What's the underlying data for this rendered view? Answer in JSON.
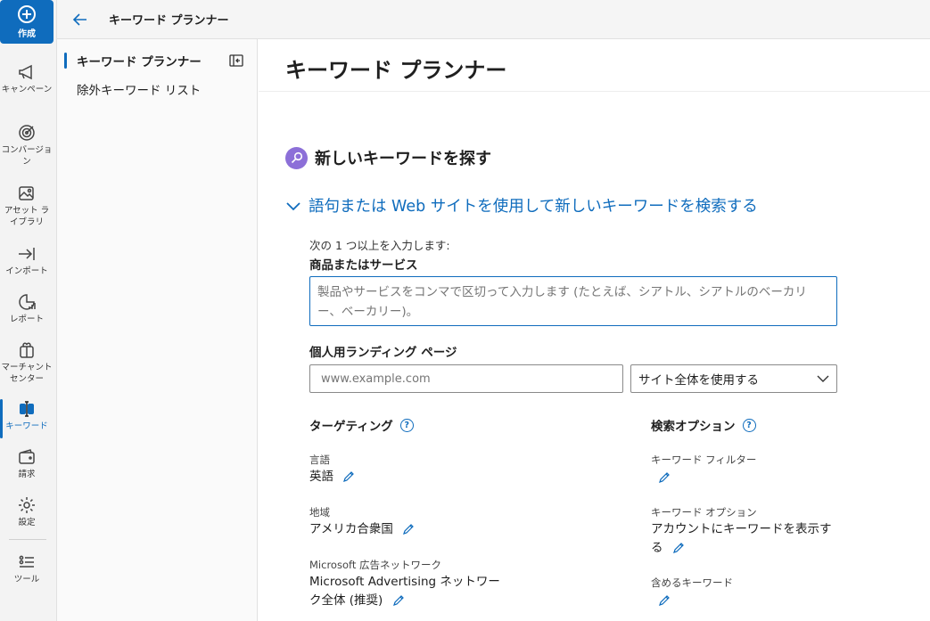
{
  "rail": {
    "create_label": "作成",
    "items": [
      {
        "label": "キャンペーン",
        "icon": "megaphone-icon"
      },
      {
        "label": "コンバージョン",
        "icon": "target-icon"
      },
      {
        "label": "アセット ライブラリ",
        "icon": "image-library-icon"
      },
      {
        "label": "インポート",
        "icon": "import-icon"
      },
      {
        "label": "レポート",
        "icon": "report-icon"
      },
      {
        "label": "マーチャント センター",
        "icon": "gift-icon"
      },
      {
        "label": "キーワード",
        "icon": "keyword-icon"
      },
      {
        "label": "請求",
        "icon": "wallet-icon"
      },
      {
        "label": "設定",
        "icon": "gear-icon"
      },
      {
        "label": "ツール",
        "icon": "tools-list-icon"
      }
    ],
    "accent": "#0f6cbd"
  },
  "topbar": {
    "title": "キーワード プランナー"
  },
  "subnav": {
    "items": [
      {
        "label": "キーワード プランナー"
      },
      {
        "label": "除外キーワード リスト"
      }
    ]
  },
  "main": {
    "title": "キーワード プランナー",
    "section_title": "新しいキーワードを探す",
    "expander_label": "語句または Web サイトを使用して新しいキーワードを検索する",
    "instruction": "次の 1 つ以上を入力します:",
    "products_label": "商品またはサービス",
    "products_placeholder": "製品やサービスをコンマで区切って入力します (たとえば、シアトル、シアトルのベーカリー、ベーカリー)。",
    "landing_label": "個人用ランディング ページ",
    "landing_placeholder": "www.example.com",
    "scope_select": "サイト全体を使用する",
    "targeting": {
      "title": "ターゲティング",
      "language_label": "言語",
      "language_value": "英語",
      "location_label": "地域",
      "location_value": "アメリカ合衆国",
      "network_label": "Microsoft 広告ネットワーク",
      "network_value": "Microsoft Advertising ネットワーク全体 (推奨)"
    },
    "search_options": {
      "title": "検索オプション",
      "filter_label": "キーワード フィルター",
      "option_label": "キーワード オプション",
      "option_value": "アカウントにキーワードを表示する",
      "include_label": "含めるキーワード"
    }
  }
}
